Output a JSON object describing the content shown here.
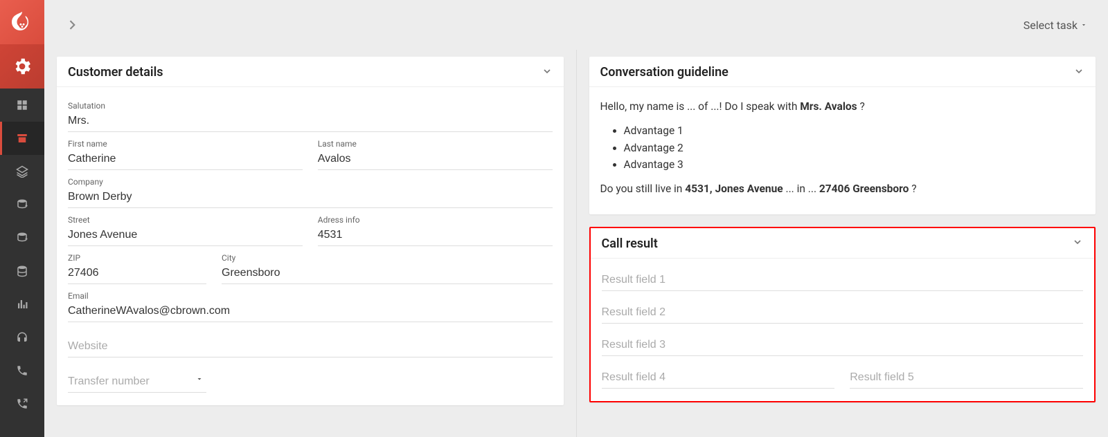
{
  "topbar": {
    "select_task_label": "Select task"
  },
  "customer_details": {
    "title": "Customer details",
    "labels": {
      "salutation": "Salutation",
      "first_name": "First name",
      "last_name": "Last name",
      "company": "Company",
      "street": "Street",
      "address_info": "Adress info",
      "zip": "ZIP",
      "city": "City",
      "email": "Email"
    },
    "values": {
      "salutation": "Mrs.",
      "first_name": "Catherine",
      "last_name": "Avalos",
      "company": "Brown Derby",
      "street": "Jones Avenue",
      "address_info": "4531",
      "zip": "27406",
      "city": "Greensboro",
      "email": "CatherineWAvalos@cbrown.com"
    },
    "placeholders": {
      "website": "Website",
      "transfer_number": "Transfer number"
    }
  },
  "guideline": {
    "title": "Conversation guideline",
    "intro_prefix": "Hello, my name is ... of ...! Do I speak with ",
    "intro_name": "Mrs. Avalos",
    "intro_suffix": " ?",
    "advantages": [
      "Advantage 1",
      "Advantage 2",
      "Advantage 3"
    ],
    "address_line_prefix": "Do you still live in ",
    "address_num": "4531, Jones Avenue",
    "address_mid": " ... in ... ",
    "address_city": "27406 Greensboro",
    "address_suffix": " ?"
  },
  "call_result": {
    "title": "Call result",
    "placeholders": {
      "f1": "Result field 1",
      "f2": "Result field 2",
      "f3": "Result field 3",
      "f4": "Result field 4",
      "f5": "Result field 5"
    }
  }
}
